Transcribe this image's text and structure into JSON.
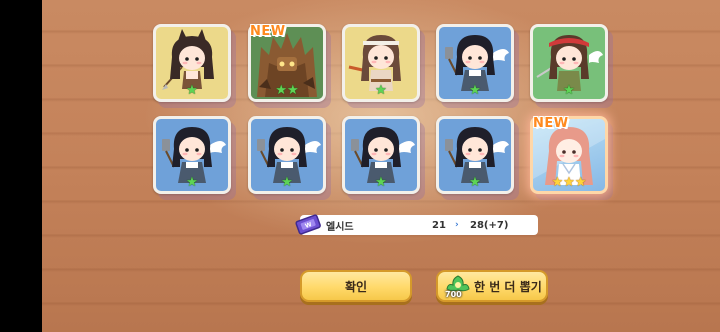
{
  "cards": [
    {
      "id": "c1",
      "bg": "yellow",
      "new": false,
      "stars": 1,
      "star_type": "green",
      "character": "cat-ear-girl-with-spear-icon"
    },
    {
      "id": "c2",
      "bg": "green",
      "new": true,
      "new_label": "NEW",
      "stars": 2,
      "star_type": "green",
      "character": "tree-golem-icon"
    },
    {
      "id": "c3",
      "bg": "yellow",
      "new": false,
      "stars": 1,
      "star_type": "green",
      "character": "headband-girl-with-sword-icon"
    },
    {
      "id": "c4",
      "bg": "blue",
      "new": false,
      "stars": 1,
      "star_type": "green",
      "character": "winged-girl-with-spatula-icon"
    },
    {
      "id": "c5",
      "bg": "green",
      "new": false,
      "stars": 1,
      "star_type": "green",
      "character": "bandana-girl-with-knife-icon"
    },
    {
      "id": "c6",
      "bg": "blue",
      "new": false,
      "stars": 1,
      "star_type": "green",
      "character": "winged-girl-with-spatula-icon"
    },
    {
      "id": "c7",
      "bg": "blue",
      "new": false,
      "stars": 1,
      "star_type": "green",
      "character": "winged-girl-with-spatula-icon"
    },
    {
      "id": "c8",
      "bg": "blue",
      "new": false,
      "stars": 1,
      "star_type": "green",
      "character": "winged-girl-with-spatula-icon"
    },
    {
      "id": "c9",
      "bg": "blue",
      "new": false,
      "stars": 1,
      "star_type": "green",
      "character": "winged-girl-with-spatula-icon"
    },
    {
      "id": "c10",
      "bg": "pink",
      "new": true,
      "new_label": "NEW",
      "stars": 3,
      "star_type": "gold",
      "character": "pink-hair-girl-icon"
    }
  ],
  "item_bar": {
    "icon": "ticket-icon",
    "name": "엘시드",
    "old_value": "21",
    "arrow": "›",
    "new_value": "28(+7)"
  },
  "buttons": {
    "confirm_label": "확인",
    "again_label": "한 번 더 뽑기",
    "again_cost": "700",
    "again_icon": "cookie-currency-icon"
  },
  "colors": {
    "background": "#c4825a",
    "card_yellow": "#ecd98a",
    "card_blue": "#6fa1d9",
    "card_green": "#78c07a",
    "button": "#ffd96a",
    "new_badge": "#ff8a1e"
  }
}
